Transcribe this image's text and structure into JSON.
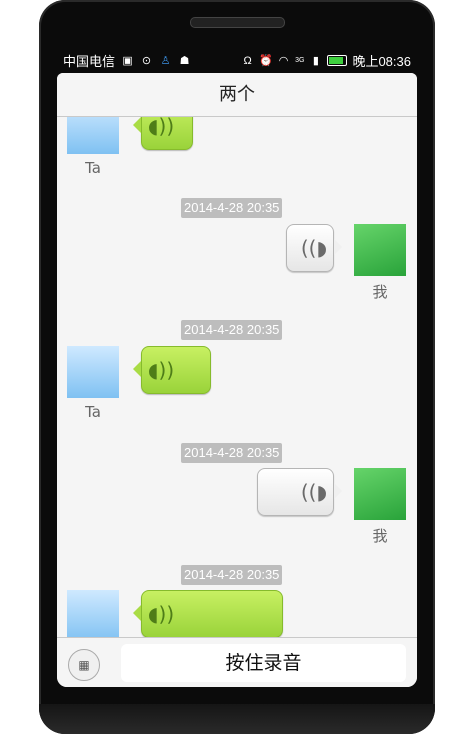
{
  "status_bar": {
    "carrier": "中国电信",
    "time": "晚上08:36",
    "network": "3G",
    "left_icons": [
      "image-icon",
      "play-icon",
      "android-download-icon",
      "android-icon"
    ],
    "right_icons": [
      "headphones-icon",
      "alarm-icon",
      "wifi-icon",
      "signal-icon",
      "battery-icon"
    ]
  },
  "header": {
    "title": "两个"
  },
  "messages": [
    {
      "sender_label": "Ta",
      "type": "voice",
      "direction": "incoming"
    },
    {
      "timestamp": "2014-4-28 20:35",
      "sender_label": "我",
      "type": "voice",
      "direction": "outgoing"
    },
    {
      "timestamp": "2014-4-28 20:35",
      "sender_label": "Ta",
      "type": "voice",
      "direction": "incoming"
    },
    {
      "timestamp": "2014-4-28 20:35",
      "sender_label": "我",
      "type": "voice",
      "direction": "outgoing"
    },
    {
      "timestamp": "2014-4-28 20:35",
      "sender_label": "",
      "type": "voice",
      "direction": "incoming"
    }
  ],
  "input_bar": {
    "keyboard_toggle_icon": "keyboard-icon",
    "hold_to_record_label": "按住录音"
  },
  "colors": {
    "incoming_bubble": "#b2e24e",
    "outgoing_bubble": "#f2f2f2",
    "timestamp_bg": "#bdbdbd",
    "phone_frame": "#0b0b0b"
  }
}
